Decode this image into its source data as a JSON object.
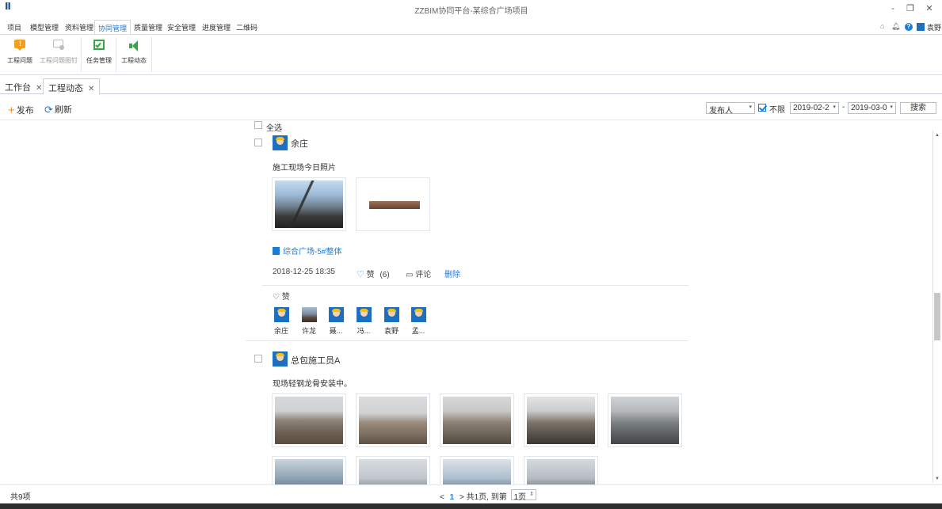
{
  "window": {
    "title": "ZZBIM协同平台-某综合广场项目",
    "minimize": "‐",
    "restore": "❐",
    "close": "✕"
  },
  "menu": {
    "items": [
      "项目",
      "模型管理",
      "资料管理",
      "协同管理",
      "质量管理",
      "安全管理",
      "进度管理",
      "二维码"
    ],
    "active_index": 3,
    "user": "袁野"
  },
  "ribbon": {
    "items": [
      {
        "label": "工程问题",
        "enabled": true
      },
      {
        "label": "工程问题图钉",
        "enabled": false
      },
      {
        "label": "任务管理",
        "enabled": true
      },
      {
        "label": "工程动态",
        "enabled": true
      }
    ]
  },
  "doc_tabs": [
    {
      "label": "工作台",
      "active": false
    },
    {
      "label": "工程动态",
      "active": true
    }
  ],
  "toolbar": {
    "publish": "发布",
    "refresh": "刷新",
    "publisher_select": "发布人",
    "unlimited_label": "不限",
    "unlimited_checked": true,
    "date_from": "2019-02-2",
    "date_to": "2019-03-0",
    "range_sep": "-",
    "search": "搜索"
  },
  "feed": {
    "select_all": "全选",
    "posts": [
      {
        "author": "余庄",
        "text": "施工现场今日照片",
        "location": "综合广场-5#整体",
        "time": "2018-12-25 18:35",
        "like_label": "赞",
        "like_count": "(6)",
        "comment_label": "评论",
        "delete_label": "删除",
        "likes_header": "赞",
        "likers": [
          "余庄",
          "许龙",
          "聂...",
          "冯...",
          "袁野",
          "孟..."
        ]
      },
      {
        "author": "总包施工员A",
        "text": "现场轻钢龙骨安装中。"
      }
    ]
  },
  "status": {
    "total": "共9项",
    "prev": "<",
    "current_page": "1",
    "next_info": "> 共1页, 到第",
    "page_select": "1页"
  }
}
